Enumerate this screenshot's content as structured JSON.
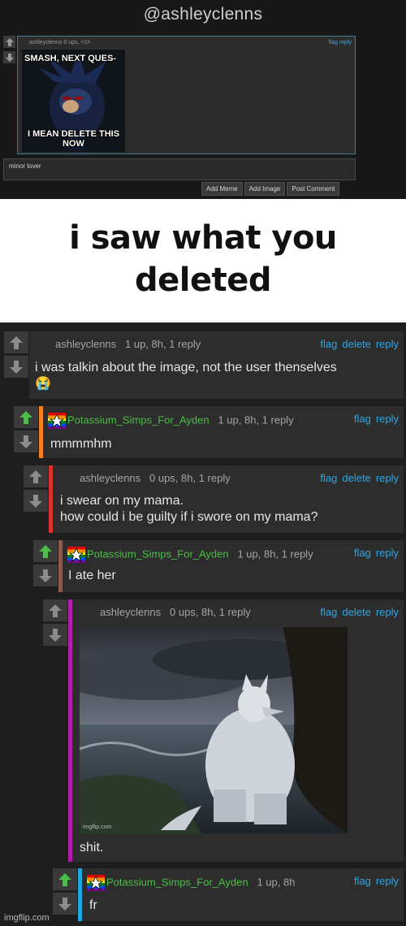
{
  "top": {
    "handle": "@ashleyclenns",
    "original_comment": {
      "meta": "ashleyclenns   0 ups, <1h",
      "actions": "flag reply",
      "meme_top": "SMASH, NEXT QUES-",
      "meme_bottom": "I MEAN DELETE THIS NOW"
    },
    "reply_input_value": "minor lover",
    "buttons": {
      "add_meme": "Add Meme",
      "add_image": "Add Image",
      "post_comment": "Post Comment"
    }
  },
  "banner": {
    "line1": "i saw what you",
    "line2": "deleted"
  },
  "comments": [
    {
      "user": "ashleyclenns",
      "stats": "1 up, 8h, 1 reply",
      "actions": [
        "flag",
        "delete",
        "reply"
      ],
      "text1": "i was talkin about the image, not the user thenselves",
      "text2": "😭",
      "bar": "#2d2d2d"
    },
    {
      "user": "Potassium_Simps_For_Ayden",
      "stats": "1 up, 8h, 1 reply",
      "actions": [
        "flag",
        "reply"
      ],
      "text1": "mmmmhm",
      "bar": "#f5821f"
    },
    {
      "user": "ashleyclenns",
      "stats": "0 ups, 8h, 1 reply",
      "actions": [
        "flag",
        "delete",
        "reply"
      ],
      "text1": "i swear on my mama.",
      "text2": "how could i be guilty if i swore on my mama?",
      "bar": "#d9322e"
    },
    {
      "user": "Potassium_Simps_For_Ayden",
      "stats": "1 up, 8h, 1 reply",
      "actions": [
        "flag",
        "reply"
      ],
      "text1": "I ate her",
      "bar": "#8a5a4e"
    },
    {
      "user": "ashleyclenns",
      "stats": "0 ups, 8h, 1 reply",
      "actions": [
        "flag",
        "delete",
        "reply"
      ],
      "text1": "shit.",
      "image_watermark": "imgflip.com",
      "bar": "#b31fa8"
    },
    {
      "user": "Potassium_Simps_For_Ayden",
      "stats": "1 up, 8h",
      "actions": [
        "flag",
        "reply"
      ],
      "text1": "fr",
      "bar": "#1fa7e0"
    }
  ],
  "footer_watermark": "imgflip.com",
  "colors": {
    "link": "#2aa7e8",
    "upvoted": "#4bbf47",
    "card_bg": "#2d2d2d",
    "page_bg": "#1e1e1e"
  }
}
